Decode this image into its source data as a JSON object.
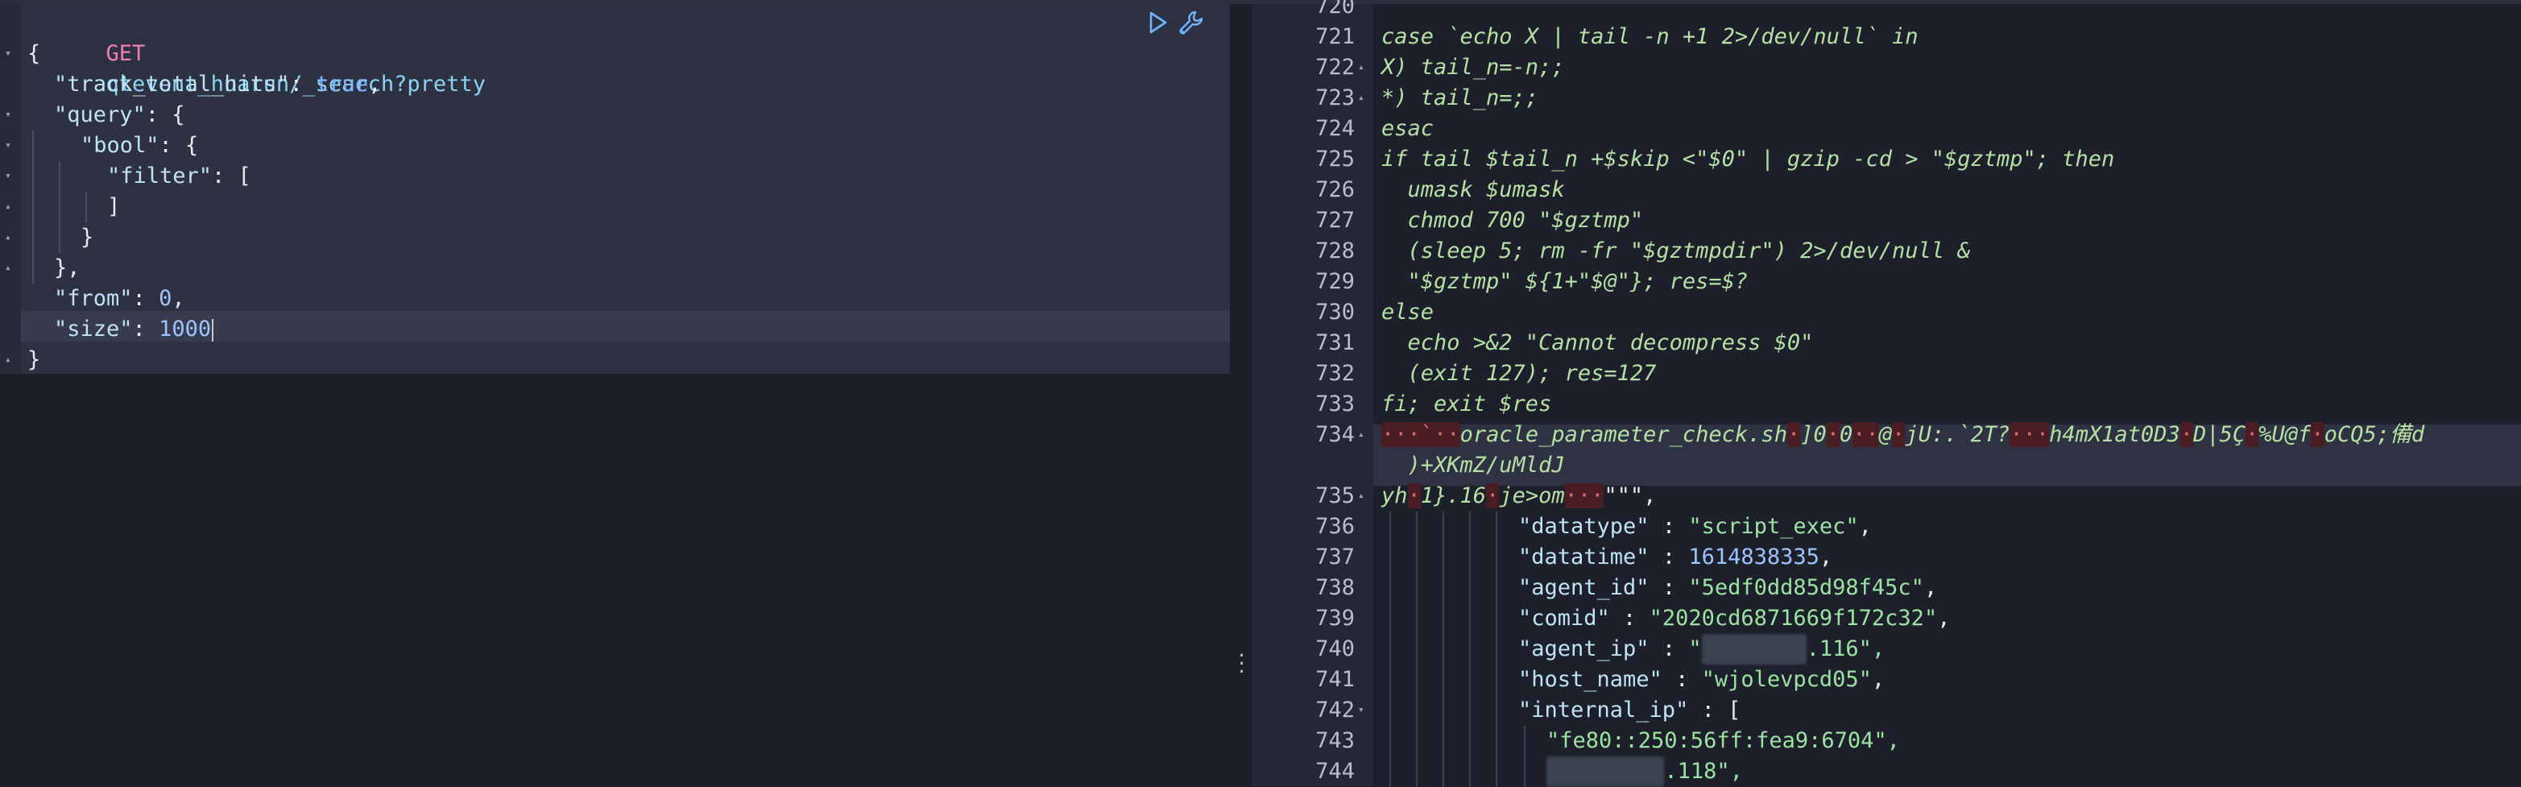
{
  "request": {
    "method": "GET",
    "path": "qtevent_huarun/_search?pretty",
    "body_lines": [
      {
        "indent": 0,
        "tokens": [
          [
            "punc",
            "{"
          ]
        ]
      },
      {
        "indent": 1,
        "tokens": [
          [
            "key",
            "\"track_total_hits\""
          ],
          [
            "punc",
            ": "
          ],
          [
            "bool",
            "true"
          ],
          [
            "punc",
            ","
          ]
        ]
      },
      {
        "indent": 1,
        "tokens": [
          [
            "key",
            "\"query\""
          ],
          [
            "punc",
            ": {"
          ]
        ]
      },
      {
        "indent": 2,
        "tokens": [
          [
            "key",
            "\"bool\""
          ],
          [
            "punc",
            ": {"
          ]
        ]
      },
      {
        "indent": 3,
        "tokens": [
          [
            "key",
            "\"filter\""
          ],
          [
            "punc",
            ": ["
          ]
        ]
      },
      {
        "indent": 3,
        "tokens": [
          [
            "punc",
            "]"
          ]
        ]
      },
      {
        "indent": 2,
        "tokens": [
          [
            "punc",
            "}"
          ]
        ]
      },
      {
        "indent": 1,
        "tokens": [
          [
            "punc",
            "},"
          ]
        ]
      },
      {
        "indent": 1,
        "tokens": [
          [
            "key",
            "\"from\""
          ],
          [
            "punc",
            ": "
          ],
          [
            "num",
            "0"
          ],
          [
            "punc",
            ","
          ]
        ]
      },
      {
        "indent": 1,
        "tokens": [
          [
            "key",
            "\"size\""
          ],
          [
            "punc",
            ": "
          ],
          [
            "num",
            "1000"
          ]
        ]
      },
      {
        "indent": 0,
        "tokens": [
          [
            "punc",
            "}"
          ]
        ]
      }
    ]
  },
  "actions": {
    "run_icon": "play-icon",
    "settings_icon": "wrench-icon"
  },
  "response": {
    "top_partial_line": "720",
    "lines": [
      {
        "n": "721",
        "fold": "",
        "text": "case `echo X | tail -n +1 2>/dev/null` in"
      },
      {
        "n": "722",
        "fold": "▴",
        "text": "X) tail_n=-n;;"
      },
      {
        "n": "723",
        "fold": "▴",
        "text": "*) tail_n=;;"
      },
      {
        "n": "724",
        "fold": "",
        "text": "esac"
      },
      {
        "n": "725",
        "fold": "",
        "text": "if tail $tail_n +$skip <\"$0\" | gzip -cd > \"$gztmp\"; then"
      },
      {
        "n": "726",
        "fold": "",
        "text": "  umask $umask"
      },
      {
        "n": "727",
        "fold": "",
        "text": "  chmod 700 \"$gztmp\""
      },
      {
        "n": "728",
        "fold": "",
        "text": "  (sleep 5; rm -fr \"$gztmpdir\") 2>/dev/null &"
      },
      {
        "n": "729",
        "fold": "",
        "text": "  \"$gztmp\" ${1+\"$@\"}; res=$?"
      },
      {
        "n": "730",
        "fold": "",
        "text": "else"
      },
      {
        "n": "731",
        "fold": "",
        "text": "  echo >&2 \"Cannot decompress $0\""
      },
      {
        "n": "732",
        "fold": "",
        "text": "  (exit 127); res=127"
      },
      {
        "n": "733",
        "fold": "",
        "text": "fi; exit $res"
      }
    ],
    "line734": {
      "n": "734",
      "row1_a": "oracle_parameter_check.sh",
      "row1_b": "]0",
      "row1_c": "0",
      "row1_d": "jU:.`2T?",
      "row1_e": "h4mX1at0D3",
      "row1_f": "D|5Ç",
      "row1_g": "%U@f",
      "row1_h": "oCQ5;備d",
      "row2": "  )+XKmZ/uMldJ"
    },
    "line735": {
      "n": "735",
      "a": "yh",
      "b": "1}.16",
      "c": "je>om",
      "d": "\"\"\","
    },
    "json_lines": [
      {
        "n": "736",
        "key": "\"datatype\"",
        "val": "\"script_exec\"",
        "vtype": "str",
        "tail": ","
      },
      {
        "n": "737",
        "key": "\"datatime\"",
        "val": "1614838335",
        "vtype": "num",
        "tail": ","
      },
      {
        "n": "738",
        "key": "\"agent_id\"",
        "val": "\"5edf0dd85d98f45c\"",
        "vtype": "str",
        "tail": ","
      },
      {
        "n": "739",
        "key": "\"comid\"",
        "val": "\"2020cd6871669f172c32\"",
        "vtype": "str",
        "tail": ","
      },
      {
        "n": "740",
        "key": "\"agent_ip\"",
        "val": "\"",
        "vtype": "str",
        "tail": ".116\","
      },
      {
        "n": "741",
        "key": "\"host_name\"",
        "val": "\"wjolevpcd05\"",
        "vtype": "str",
        "tail": ","
      },
      {
        "n": "742",
        "key": "\"internal_ip\"",
        "val": "[",
        "vtype": "punc",
        "tail": ""
      }
    ],
    "line743": {
      "n": "743",
      "text": "\"fe80::250:56ff:fea9:6704\","
    },
    "line744": {
      "n": "744",
      "text": ".118\","
    }
  }
}
